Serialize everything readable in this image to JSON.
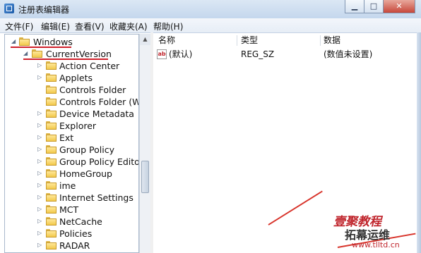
{
  "window": {
    "title": "注册表编辑器"
  },
  "menu": [
    "文件(F)",
    "编辑(E)",
    "查看(V)",
    "收藏夹(A)",
    "帮助(H)"
  ],
  "tree": {
    "root": "Windows",
    "current": "CurrentVersion",
    "children": [
      "Action Center",
      "Applets",
      "Controls Folder",
      "Controls Folder (Wo",
      "Device Metadata",
      "Explorer",
      "Ext",
      "Group Policy",
      "Group Policy Editor",
      "HomeGroup",
      "ime",
      "Internet Settings",
      "MCT",
      "NetCache",
      "Policies",
      "RADAR"
    ]
  },
  "list": {
    "columns": [
      "名称",
      "类型",
      "数据"
    ],
    "rows": [
      {
        "name": "(默认)",
        "type": "REG_SZ",
        "data": "(数值未设置)"
      }
    ]
  },
  "watermark": {
    "line1": "壹聚教程",
    "line2": "拓幕运维",
    "url": "www.tlltd.cn"
  },
  "colors": {
    "highlight": "#d0202a",
    "watermark": "#c0262d"
  }
}
